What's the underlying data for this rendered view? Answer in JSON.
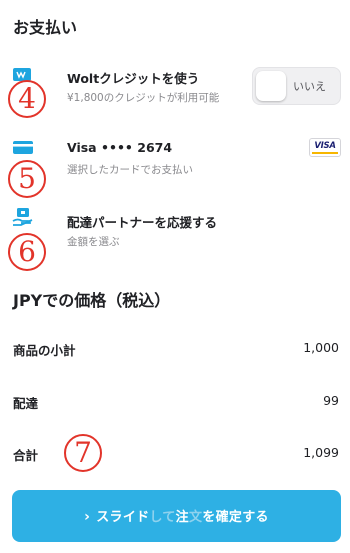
{
  "payment": {
    "title": "お支払い",
    "credit": {
      "title": "Woltクレジットを使う",
      "subtitle": "¥1,800のクレジットが利用可能",
      "toggle_label": "いいえ"
    },
    "card": {
      "title": "Visa •••• 2674",
      "subtitle": "選択したカードでお支払い",
      "brand": "VISA"
    },
    "tip": {
      "title": "配達パートナーを応援する",
      "subtitle": "金額を選ぶ"
    }
  },
  "annotations": [
    "4",
    "5",
    "6",
    "7"
  ],
  "pricing": {
    "title": "JPYでの価格（税込）",
    "rows": [
      {
        "label": "商品の小計",
        "value": "1,000"
      },
      {
        "label": "配達",
        "value": "99"
      },
      {
        "label": "合計",
        "value": "1,099"
      }
    ]
  },
  "slide_button": {
    "chevron": "›",
    "text_a": "スライド",
    "text_b": "して",
    "text_c": "注",
    "text_d": "文",
    "text_e": "を",
    "text_f": "確定する"
  },
  "colors": {
    "accent": "#2eb0e4",
    "annotation": "#e2342a",
    "icon_blue": "#1ea5df"
  }
}
